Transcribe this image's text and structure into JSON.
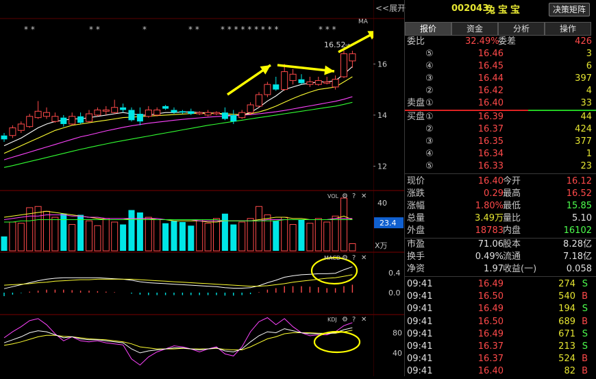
{
  "chart": {
    "expand_label": "<<展开",
    "ma_label": "MA",
    "price_annotation": "16.52",
    "stars": [
      "* *",
      "* *",
      "*",
      "* *",
      "* * * * * * * * *",
      "* * *"
    ],
    "price_ticks": [
      "16",
      "14",
      "12"
    ],
    "vol_title": "VOL",
    "vol_ticks": [
      "40",
      "23.4",
      "X万"
    ],
    "macd_title": "MACD",
    "macd_ticks": [
      "0.4",
      "0.0"
    ],
    "kdj_title": "KDJ",
    "kdj_ticks": [
      "80",
      "40"
    ],
    "panel_icons": {
      "gear": "⚙",
      "help": "?",
      "close": "✕"
    }
  },
  "chart_data": {
    "type": "candlestick",
    "price_axis": {
      "ticks": [
        12,
        14,
        16
      ],
      "range": [
        11.1,
        17.7
      ]
    },
    "candles": [
      {
        "o": 13.05,
        "c": 13.2,
        "h": 13.3,
        "l": 12.95,
        "up": false
      },
      {
        "o": 13.2,
        "c": 13.5,
        "h": 13.6,
        "l": 13.1,
        "up": true
      },
      {
        "o": 13.4,
        "c": 13.65,
        "h": 13.75,
        "l": 13.3,
        "up": true
      },
      {
        "o": 13.55,
        "c": 13.95,
        "h": 14.05,
        "l": 13.5,
        "up": true
      },
      {
        "o": 13.9,
        "c": 14.15,
        "h": 14.55,
        "l": 13.85,
        "up": true
      },
      {
        "o": 14.1,
        "c": 13.95,
        "h": 14.3,
        "l": 13.85,
        "up": true
      },
      {
        "o": 13.75,
        "c": 13.95,
        "h": 14.1,
        "l": 13.7,
        "up": true
      },
      {
        "o": 13.9,
        "c": 13.65,
        "h": 14.0,
        "l": 13.55,
        "up": false
      },
      {
        "o": 13.65,
        "c": 13.95,
        "h": 14.1,
        "l": 13.6,
        "up": true
      },
      {
        "o": 13.95,
        "c": 13.7,
        "h": 14.1,
        "l": 13.65,
        "up": false
      },
      {
        "o": 13.75,
        "c": 14.05,
        "h": 14.2,
        "l": 13.7,
        "up": true
      },
      {
        "o": 14.0,
        "c": 14.2,
        "h": 14.3,
        "l": 13.95,
        "up": true
      },
      {
        "o": 14.2,
        "c": 14.15,
        "h": 14.35,
        "l": 14.0,
        "up": true
      },
      {
        "o": 14.1,
        "c": 14.3,
        "h": 14.6,
        "l": 14.05,
        "up": true
      },
      {
        "o": 14.3,
        "c": 14.2,
        "h": 14.45,
        "l": 14.1,
        "up": false
      },
      {
        "o": 14.2,
        "c": 13.8,
        "h": 14.3,
        "l": 13.75,
        "up": false
      },
      {
        "o": 14.05,
        "c": 13.75,
        "h": 14.3,
        "l": 13.6,
        "up": false
      },
      {
        "o": 13.95,
        "c": 14.2,
        "h": 14.35,
        "l": 13.9,
        "up": true
      },
      {
        "o": 14.2,
        "c": 14.0,
        "h": 14.3,
        "l": 13.95,
        "up": true
      },
      {
        "o": 14.25,
        "c": 14.35,
        "h": 14.4,
        "l": 14.2,
        "up": false
      },
      {
        "o": 14.2,
        "c": 14.1,
        "h": 14.3,
        "l": 14.05,
        "up": false
      },
      {
        "o": 14.1,
        "c": 14.15,
        "h": 14.2,
        "l": 14.05,
        "up": false
      },
      {
        "o": 14.15,
        "c": 14.05,
        "h": 14.25,
        "l": 14.0,
        "up": false
      },
      {
        "o": 14.05,
        "c": 14.1,
        "h": 14.15,
        "l": 14.0,
        "up": true
      },
      {
        "o": 14.1,
        "c": 14.0,
        "h": 14.2,
        "l": 13.95,
        "up": true
      },
      {
        "o": 14.05,
        "c": 14.1,
        "h": 14.15,
        "l": 14.0,
        "up": true
      },
      {
        "o": 14.1,
        "c": 13.85,
        "h": 14.3,
        "l": 13.8,
        "up": false
      },
      {
        "o": 14.0,
        "c": 13.75,
        "h": 14.2,
        "l": 13.65,
        "up": false
      },
      {
        "o": 13.9,
        "c": 14.1,
        "h": 14.2,
        "l": 13.85,
        "up": true
      },
      {
        "o": 14.1,
        "c": 14.4,
        "h": 14.5,
        "l": 14.0,
        "up": true
      },
      {
        "o": 14.35,
        "c": 14.8,
        "h": 14.9,
        "l": 14.3,
        "up": true
      },
      {
        "o": 14.8,
        "c": 15.2,
        "h": 15.3,
        "l": 14.7,
        "up": true
      },
      {
        "o": 15.2,
        "c": 15.0,
        "h": 15.5,
        "l": 14.95,
        "up": false
      },
      {
        "o": 15.0,
        "c": 15.7,
        "h": 16.0,
        "l": 14.95,
        "up": true
      },
      {
        "o": 15.6,
        "c": 15.35,
        "h": 15.8,
        "l": 15.2,
        "up": true
      },
      {
        "o": 15.4,
        "c": 15.25,
        "h": 15.6,
        "l": 15.2,
        "up": false
      },
      {
        "o": 15.3,
        "c": 15.2,
        "h": 15.5,
        "l": 15.1,
        "up": true
      },
      {
        "o": 15.2,
        "c": 15.35,
        "h": 15.5,
        "l": 15.15,
        "up": true
      },
      {
        "o": 15.3,
        "c": 15.25,
        "h": 15.5,
        "l": 15.2,
        "up": true
      },
      {
        "o": 15.1,
        "c": 15.4,
        "h": 15.55,
        "l": 15.0,
        "up": true
      },
      {
        "o": 15.5,
        "c": 16.4,
        "h": 16.52,
        "l": 15.45,
        "up": true
      },
      {
        "o": 16.12,
        "c": 16.4,
        "h": 16.52,
        "l": 15.85,
        "up": true
      }
    ],
    "ma": [
      {
        "color": "#ffffff",
        "values": [
          12.8,
          12.95,
          13.1,
          13.3,
          13.5,
          13.65,
          13.75,
          13.8,
          13.85,
          13.85,
          13.9,
          13.95,
          14.0,
          14.05,
          14.1,
          14.05,
          14.0,
          14.0,
          14.05,
          14.1,
          14.1,
          14.12,
          14.12,
          14.1,
          14.08,
          14.08,
          14.0,
          13.98,
          14.0,
          14.1,
          14.3,
          14.55,
          14.75,
          15.0,
          15.1,
          15.2,
          15.25,
          15.3,
          15.3,
          15.35,
          15.6,
          15.9
        ]
      },
      {
        "color": "#ffff32",
        "values": [
          12.5,
          12.65,
          12.8,
          12.95,
          13.1,
          13.25,
          13.4,
          13.5,
          13.6,
          13.65,
          13.7,
          13.75,
          13.8,
          13.85,
          13.9,
          13.92,
          13.94,
          13.96,
          13.98,
          14.0,
          14.02,
          14.04,
          14.06,
          14.07,
          14.07,
          14.07,
          14.05,
          14.03,
          14.02,
          14.05,
          14.12,
          14.22,
          14.35,
          14.5,
          14.65,
          14.78,
          14.9,
          15.0,
          15.05,
          15.1,
          15.3,
          15.5
        ]
      },
      {
        "color": "#ff44ff",
        "values": [
          12.25,
          12.35,
          12.45,
          12.55,
          12.65,
          12.75,
          12.85,
          12.95,
          13.05,
          13.15,
          13.22,
          13.3,
          13.38,
          13.45,
          13.52,
          13.58,
          13.63,
          13.68,
          13.72,
          13.76,
          13.8,
          13.83,
          13.86,
          13.89,
          13.92,
          13.94,
          13.96,
          13.98,
          14.0,
          14.02,
          14.05,
          14.09,
          14.13,
          14.18,
          14.24,
          14.3,
          14.36,
          14.42,
          14.48,
          14.54,
          14.62,
          14.72
        ]
      },
      {
        "color": "#32ff32",
        "values": [
          11.95,
          12.02,
          12.1,
          12.18,
          12.26,
          12.34,
          12.42,
          12.5,
          12.58,
          12.66,
          12.73,
          12.8,
          12.87,
          12.94,
          13.0,
          13.06,
          13.12,
          13.18,
          13.24,
          13.3,
          13.36,
          13.42,
          13.48,
          13.54,
          13.6,
          13.65,
          13.7,
          13.75,
          13.8,
          13.85,
          13.9,
          13.95,
          14.0,
          14.05,
          14.1,
          14.15,
          14.2,
          14.25,
          14.3,
          14.35,
          14.42,
          14.5
        ]
      }
    ],
    "volume": {
      "ticks": [
        40,
        23.4
      ],
      "unit": "X万",
      "values": [
        12,
        24,
        23,
        36,
        37,
        33,
        28,
        31,
        22,
        30,
        25,
        21,
        27,
        24,
        22,
        34,
        32,
        28,
        26,
        23,
        25,
        24,
        21,
        26,
        23,
        27,
        31,
        22,
        24,
        27,
        37,
        30,
        25,
        28,
        22,
        26,
        23,
        27,
        24,
        29,
        44,
        6
      ],
      "ma": [
        {
          "color": "#ffff32",
          "values": [
            28,
            29,
            30,
            31,
            32,
            33,
            32,
            31,
            30,
            29,
            28,
            27,
            26,
            26,
            26,
            27,
            27,
            27,
            26,
            26,
            25,
            25,
            25,
            25,
            24,
            24,
            25,
            25,
            25,
            25,
            26,
            27,
            28,
            28,
            27,
            27,
            26,
            26,
            26,
            27,
            29,
            26
          ]
        },
        {
          "color": "#ff44ff",
          "values": [
            26,
            27,
            28,
            29,
            29,
            30,
            30,
            30,
            29,
            29,
            28,
            28,
            27,
            27,
            27,
            27,
            27,
            27,
            27,
            26,
            26,
            26,
            26,
            25,
            25,
            25,
            25,
            25,
            25,
            25,
            25,
            26,
            26,
            26,
            26,
            26,
            26,
            26,
            26,
            27,
            27,
            27
          ]
        },
        {
          "color": "#32ff32",
          "values": [
            24,
            24,
            25,
            25,
            26,
            26,
            26,
            26,
            26,
            26,
            26,
            26,
            26,
            26,
            26,
            26,
            26,
            26,
            26,
            26,
            26,
            26,
            26,
            26,
            26,
            26,
            25,
            25,
            25,
            25,
            25,
            25,
            25,
            26,
            26,
            26,
            26,
            26,
            26,
            26,
            26,
            26
          ]
        }
      ]
    },
    "macd": {
      "ticks": [
        0.4,
        0.0
      ],
      "dif": [
        0.08,
        0.12,
        0.16,
        0.2,
        0.24,
        0.27,
        0.29,
        0.3,
        0.3,
        0.3,
        0.3,
        0.3,
        0.29,
        0.28,
        0.27,
        0.25,
        0.22,
        0.2,
        0.19,
        0.18,
        0.17,
        0.16,
        0.15,
        0.14,
        0.13,
        0.12,
        0.1,
        0.09,
        0.09,
        0.1,
        0.14,
        0.2,
        0.25,
        0.31,
        0.34,
        0.36,
        0.37,
        0.38,
        0.38,
        0.39,
        0.46,
        0.52
      ],
      "dea": [
        0.15,
        0.16,
        0.17,
        0.18,
        0.2,
        0.21,
        0.23,
        0.24,
        0.25,
        0.26,
        0.26,
        0.27,
        0.27,
        0.27,
        0.27,
        0.27,
        0.26,
        0.25,
        0.24,
        0.23,
        0.22,
        0.21,
        0.2,
        0.19,
        0.18,
        0.17,
        0.16,
        0.15,
        0.14,
        0.13,
        0.13,
        0.14,
        0.16,
        0.18,
        0.21,
        0.23,
        0.25,
        0.27,
        0.29,
        0.3,
        0.33,
        0.36
      ],
      "hist": [
        -0.07,
        -0.04,
        -0.01,
        0.02,
        0.04,
        0.06,
        0.06,
        0.06,
        0.05,
        0.04,
        0.04,
        0.03,
        0.02,
        0.01,
        0.0,
        -0.02,
        -0.04,
        -0.05,
        -0.05,
        -0.05,
        -0.05,
        -0.05,
        -0.05,
        -0.05,
        -0.05,
        -0.05,
        -0.06,
        -0.06,
        -0.05,
        -0.03,
        0.01,
        0.06,
        0.09,
        0.13,
        0.13,
        0.13,
        0.12,
        0.11,
        0.09,
        0.09,
        0.13,
        0.16
      ]
    },
    "kdj": {
      "ticks": [
        80,
        40
      ],
      "k": [
        60,
        66,
        72,
        80,
        84,
        82,
        76,
        70,
        72,
        68,
        66,
        66,
        64,
        62,
        60,
        48,
        40,
        44,
        46,
        48,
        50,
        50,
        48,
        46,
        48,
        50,
        44,
        42,
        48,
        62,
        74,
        82,
        80,
        88,
        84,
        80,
        78,
        78,
        78,
        80,
        86,
        90
      ],
      "d": [
        55,
        58,
        62,
        67,
        72,
        75,
        75,
        73,
        72,
        70,
        68,
        67,
        66,
        64,
        62,
        58,
        52,
        50,
        48,
        48,
        48,
        49,
        48,
        48,
        48,
        49,
        47,
        46,
        46,
        52,
        60,
        68,
        72,
        78,
        80,
        80,
        80,
        79,
        79,
        79,
        82,
        85
      ],
      "j": [
        70,
        82,
        92,
        104,
        108,
        96,
        78,
        64,
        72,
        64,
        62,
        64,
        60,
        58,
        56,
        28,
        16,
        32,
        42,
        48,
        54,
        52,
        48,
        42,
        48,
        52,
        38,
        34,
        52,
        82,
        102,
        110,
        96,
        108,
        92,
        80,
        74,
        76,
        76,
        82,
        94,
        100
      ]
    }
  },
  "quote": {
    "code": "002043",
    "name": "兔宝宝",
    "decision_button": "决策矩阵",
    "tabs": [
      "报价",
      "资金",
      "分析",
      "操作"
    ],
    "wei": {
      "label": "委比",
      "ratio": "32.49%",
      "diff_label": "委差",
      "diff": "426"
    },
    "sell": [
      {
        "idx": "⑤",
        "price": "16.46",
        "vol": "3"
      },
      {
        "idx": "④",
        "price": "16.45",
        "vol": "6"
      },
      {
        "idx": "③",
        "price": "16.44",
        "vol": "397"
      },
      {
        "idx": "②",
        "price": "16.42",
        "vol": "4"
      },
      {
        "idx": "①",
        "price": "16.40",
        "vol": "33"
      }
    ],
    "sell_label": "卖盘",
    "buy_label": "买盘",
    "buy": [
      {
        "idx": "①",
        "price": "16.39",
        "vol": "44"
      },
      {
        "idx": "②",
        "price": "16.37",
        "vol": "424"
      },
      {
        "idx": "③",
        "price": "16.35",
        "vol": "377"
      },
      {
        "idx": "④",
        "price": "16.34",
        "vol": "1"
      },
      {
        "idx": "⑤",
        "price": "16.33",
        "vol": "23"
      }
    ],
    "stats": [
      {
        "l1": "现价",
        "v1": "16.40",
        "c1": "red",
        "l2": "今开",
        "v2": "16.12",
        "c2": "red"
      },
      {
        "l1": "涨跌",
        "v1": "0.29",
        "c1": "red",
        "l2": "最高",
        "v2": "16.52",
        "c2": "red"
      },
      {
        "l1": "涨幅",
        "v1": "1.80%",
        "c1": "red",
        "l2": "最低",
        "v2": "15.85",
        "c2": "green"
      },
      {
        "l1": "总量",
        "v1": "3.49万",
        "c1": "yel",
        "l2": "量比",
        "v2": "5.10",
        "c2": "white"
      },
      {
        "l1": "外盘",
        "v1": "18783",
        "c1": "red",
        "l2": "内盘",
        "v2": "16102",
        "c2": "green"
      }
    ],
    "stats2": [
      {
        "l1": "市盈",
        "v1": "71.06",
        "c1": "white",
        "l2": "股本",
        "v2": "8.28亿",
        "c2": "white"
      },
      {
        "l1": "换手",
        "v1": "0.49%",
        "c1": "white",
        "l2": "流通",
        "v2": "7.18亿",
        "c2": "white"
      },
      {
        "l1": "净资",
        "v1": "1.97",
        "c1": "white",
        "l2": "收益(一)",
        "v2": "0.058",
        "c2": "white"
      }
    ],
    "trades": [
      {
        "time": "09:41",
        "price": "16.49",
        "vol": "274",
        "side": "S"
      },
      {
        "time": "09:41",
        "price": "16.50",
        "vol": "540",
        "side": "B"
      },
      {
        "time": "09:41",
        "price": "16.49",
        "vol": "194",
        "side": "S"
      },
      {
        "time": "09:41",
        "price": "16.50",
        "vol": "689",
        "side": "B"
      },
      {
        "time": "09:41",
        "price": "16.49",
        "vol": "671",
        "side": "S"
      },
      {
        "time": "09:41",
        "price": "16.37",
        "vol": "213",
        "side": "S"
      },
      {
        "time": "09:41",
        "price": "16.37",
        "vol": "524",
        "side": "B"
      },
      {
        "time": "09:41",
        "price": "16.40",
        "vol": "82",
        "side": "B"
      }
    ],
    "colors": {
      "up": "#ff4a4a",
      "down": "#00e6e6",
      "sell_side": "#4dff4d",
      "buy_side": "#ff4a4a"
    }
  }
}
